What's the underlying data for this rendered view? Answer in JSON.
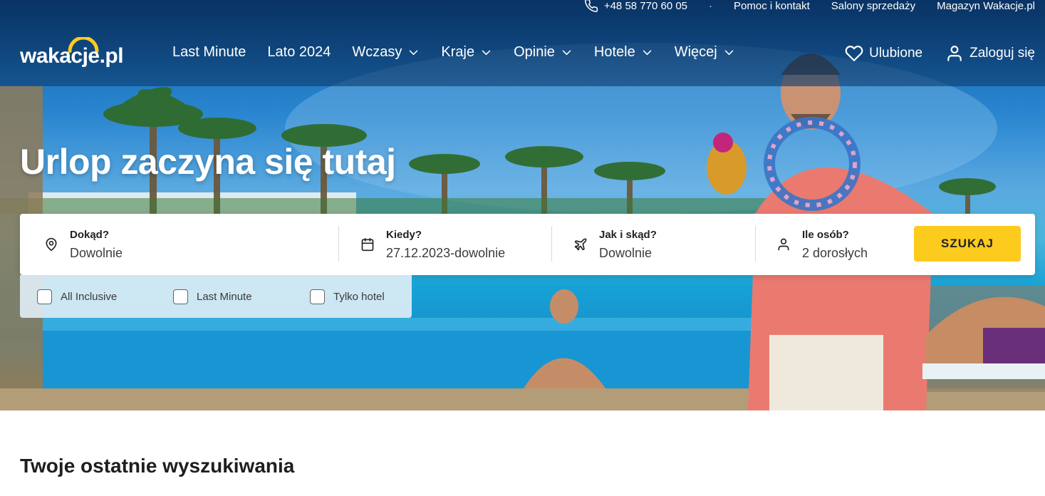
{
  "header": {
    "phone": "+48 58 770 60 05",
    "separator": "·",
    "help_link": "Pomoc i kontakt",
    "stores_link": "Salony sprzedaży",
    "magazine_link": "Magazyn Wakacje.pl",
    "logo_text": "wakacje.pl"
  },
  "nav": {
    "items": [
      {
        "label": "Last Minute",
        "dropdown": false
      },
      {
        "label": "Lato 2024",
        "dropdown": false
      },
      {
        "label": "Wczasy",
        "dropdown": true
      },
      {
        "label": "Kraje",
        "dropdown": true
      },
      {
        "label": "Opinie",
        "dropdown": true
      },
      {
        "label": "Hotele",
        "dropdown": true
      },
      {
        "label": "Więcej",
        "dropdown": true
      }
    ],
    "favorites": "Ulubione",
    "login": "Zaloguj się"
  },
  "hero": {
    "headline": "Urlop zaczyna się tutaj"
  },
  "search": {
    "destination": {
      "label": "Dokąd?",
      "value": "Dowolnie"
    },
    "when": {
      "label": "Kiedy?",
      "value": "27.12.2023-dowolnie"
    },
    "transport": {
      "label": "Jak i skąd?",
      "value": "Dowolnie"
    },
    "people": {
      "label": "Ile osób?",
      "value": "2 dorosłych"
    },
    "button": "SZUKAJ"
  },
  "filters": [
    {
      "label": "All Inclusive",
      "checked": false
    },
    {
      "label": "Last Minute",
      "checked": false
    },
    {
      "label": "Tylko hotel",
      "checked": false
    }
  ],
  "recent": {
    "title": "Twoje ostatnie wyszukiwania"
  },
  "colors": {
    "accent": "#fccb1d",
    "header_overlay": "#0e3e70",
    "text": "#1e1e1e"
  },
  "icons": {
    "phone": "phone-icon",
    "heart": "heart-icon",
    "user": "user-icon",
    "pin": "map-pin-icon",
    "calendar": "calendar-icon",
    "plane": "plane-icon",
    "person": "person-icon",
    "chevron": "chevron-down-icon"
  }
}
